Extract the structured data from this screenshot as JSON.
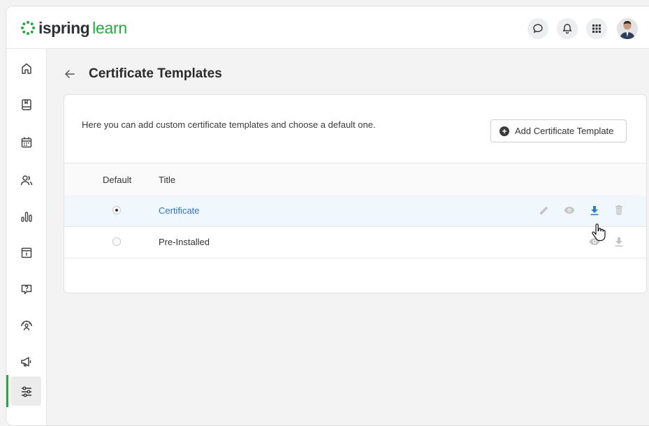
{
  "brand": {
    "name_bold": "ispring",
    "name_light": "learn",
    "accent": "#29a745"
  },
  "topbar": {
    "icons": [
      "chat-icon",
      "bell-icon",
      "apps-grid-icon"
    ],
    "avatar": "user-avatar"
  },
  "sidebar": {
    "items": [
      {
        "icon": "home-icon",
        "active": false
      },
      {
        "icon": "book-icon",
        "active": false
      },
      {
        "icon": "calendar-icon",
        "active": false
      },
      {
        "icon": "users-icon",
        "active": false
      },
      {
        "icon": "reports-icon",
        "active": false
      },
      {
        "icon": "info-card-icon",
        "active": false
      },
      {
        "icon": "question-icon",
        "active": false
      },
      {
        "icon": "gauge-user-icon",
        "active": false
      },
      {
        "icon": "megaphone-icon",
        "active": false
      },
      {
        "icon": "settings-sliders-icon",
        "active": true
      }
    ]
  },
  "page": {
    "title": "Certificate Templates",
    "description": "Here you can add custom certificate templates and choose a default one.",
    "add_button_label": "Add Certificate Template"
  },
  "table": {
    "columns": [
      "Default",
      "Title"
    ],
    "rows": [
      {
        "title": "Certificate",
        "default": true,
        "actions": [
          "edit-icon",
          "eye-icon",
          "download-icon",
          "trash-icon"
        ]
      },
      {
        "title": "Pre-Installed",
        "default": false,
        "actions": [
          "eye-icon",
          "download-icon"
        ]
      }
    ]
  },
  "colors": {
    "link": "#2f73b8",
    "action": "#2d7ec9",
    "muted_icon": "#c4c4c4"
  }
}
